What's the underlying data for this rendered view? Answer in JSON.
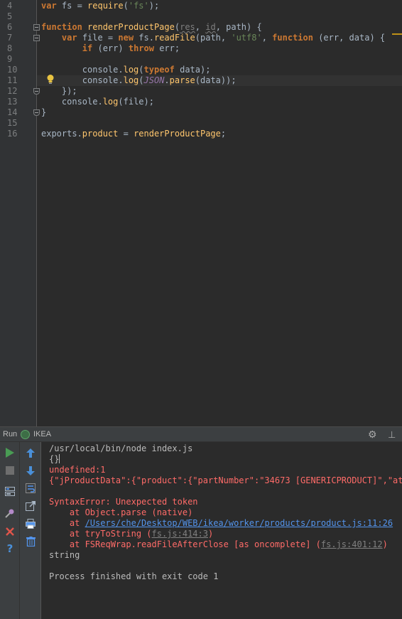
{
  "editor": {
    "line_numbers": [
      "4",
      "5",
      "6",
      "7",
      "8",
      "9",
      "10",
      "11",
      "12",
      "13",
      "14",
      "15",
      "16"
    ],
    "lines": [
      {
        "segments": [
          {
            "t": "var ",
            "c": "kw"
          },
          {
            "t": "fs = "
          },
          {
            "t": "require",
            "c": "fn"
          },
          {
            "t": "("
          },
          {
            "t": "'fs'",
            "c": "str"
          },
          {
            "t": ");"
          }
        ]
      },
      {
        "segments": []
      },
      {
        "segments": [
          {
            "t": "function ",
            "c": "kw"
          },
          {
            "t": "renderProductPage",
            "c": "fn"
          },
          {
            "t": "("
          },
          {
            "t": "res",
            "c": "unused"
          },
          {
            "t": ", "
          },
          {
            "t": "id",
            "c": "unused"
          },
          {
            "t": ", path) {"
          }
        ]
      },
      {
        "segments": [
          {
            "t": "    "
          },
          {
            "t": "var ",
            "c": "kw"
          },
          {
            "t": "file = "
          },
          {
            "t": "new ",
            "c": "kw"
          },
          {
            "t": "fs."
          },
          {
            "t": "readFile",
            "c": "fn"
          },
          {
            "t": "(path, "
          },
          {
            "t": "'utf8'",
            "c": "str"
          },
          {
            "t": ", "
          },
          {
            "t": "function ",
            "c": "kw"
          },
          {
            "t": "(err, data) {"
          }
        ]
      },
      {
        "segments": [
          {
            "t": "        "
          },
          {
            "t": "if ",
            "c": "kw"
          },
          {
            "t": "(err) "
          },
          {
            "t": "throw ",
            "c": "kw"
          },
          {
            "t": "err;"
          }
        ]
      },
      {
        "segments": []
      },
      {
        "segments": [
          {
            "t": "        console."
          },
          {
            "t": "log",
            "c": "fn"
          },
          {
            "t": "("
          },
          {
            "t": "typeof ",
            "c": "kw"
          },
          {
            "t": "data);"
          }
        ]
      },
      {
        "segments": [
          {
            "t": "        console."
          },
          {
            "t": "log",
            "c": "fn"
          },
          {
            "t": "("
          },
          {
            "t": "JSON",
            "c": "builtin"
          },
          {
            "t": "."
          },
          {
            "t": "parse",
            "c": "fn"
          },
          {
            "t": "(data));"
          }
        ]
      },
      {
        "segments": [
          {
            "t": "    });"
          }
        ]
      },
      {
        "segments": [
          {
            "t": "    console."
          },
          {
            "t": "log",
            "c": "fn"
          },
          {
            "t": "(file);"
          }
        ]
      },
      {
        "segments": [
          {
            "t": "}"
          }
        ]
      },
      {
        "segments": []
      },
      {
        "segments": [
          {
            "t": "exports."
          },
          {
            "t": "product",
            "c": "fn"
          },
          {
            "t": " = "
          },
          {
            "t": "renderProductPage",
            "c": "fn"
          },
          {
            "t": ";"
          }
        ]
      }
    ],
    "current_line_index": 7,
    "intention_icon": "lightbulb-icon"
  },
  "run_panel": {
    "tab_label": "Run",
    "config_name": "IKEA",
    "config_icon": "nodejs-icon",
    "header_icons": [
      "gear-icon",
      "pin-icon"
    ],
    "left_toolbar": [
      "rerun-icon",
      "stop-icon",
      "layout-icon",
      "pin-tab-icon",
      "close-icon",
      "help-icon"
    ],
    "right_toolbar": [
      "scroll-up-icon",
      "scroll-down-icon",
      "soft-wrap-icon",
      "export-icon",
      "print-icon",
      "trash-icon"
    ]
  },
  "console": {
    "command": "/usr/local/bin/node index.js",
    "typeof_output": "{}",
    "undefined_line": "undefined:1",
    "json_line": "{\"jProductData\":{\"product\":{\"partNumber\":\"34673 [GENERICPRODUCT]\",\"at",
    "error_title": "SyntaxError: Unexpected token",
    "stack": {
      "frame1": "    at Object.parse (native)",
      "frame2_prefix": "    at ",
      "frame2_link": "/Users/che/Desktop/WEB/ikea/worker/products/product.js:11:26",
      "frame3_prefix": "    at tryToString (",
      "frame3_link": "fs.js:414:3",
      "frame3_suffix": ")",
      "frame4_prefix": "    at FSReqWrap.readFileAfterClose [as oncomplete] (",
      "frame4_link": "fs.js:401:12",
      "frame4_suffix": ")"
    },
    "string_line": "string",
    "exit_line": "Process finished with exit code 1"
  }
}
